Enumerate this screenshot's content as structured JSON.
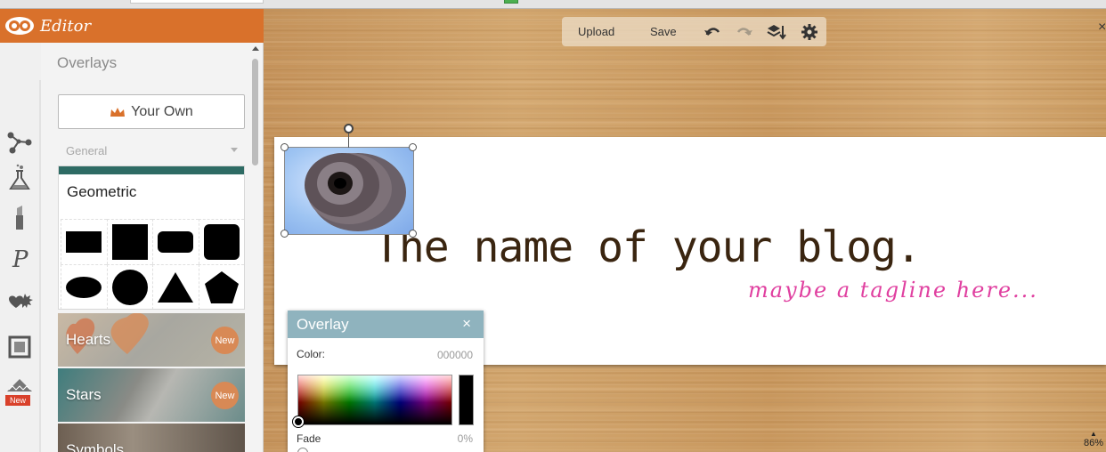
{
  "app": {
    "title": "Editor"
  },
  "toolbar": {
    "upload": "Upload",
    "save": "Save"
  },
  "sidebar": {
    "panel_title": "Overlays",
    "your_own_label": "Your Own",
    "category_select": "General",
    "geometric_title": "Geometric",
    "categories": [
      {
        "label": "Hearts",
        "badge": "New"
      },
      {
        "label": "Stars",
        "badge": "New"
      },
      {
        "label": "Symbols",
        "badge": ""
      }
    ],
    "new_badge_icon_label": "New"
  },
  "canvas": {
    "blog_name": "The name of your blog.",
    "tagline": "maybe a tagline here..."
  },
  "overlay_panel": {
    "title": "Overlay",
    "close": "×",
    "color_label": "Color:",
    "color_value": "000000",
    "fade_label": "Fade",
    "fade_value": "0%",
    "color_hex": "#000000"
  },
  "zoom": {
    "up": "▲",
    "value": "86%"
  },
  "window": {
    "close": "×"
  },
  "colors": {
    "brand": "#d9712b",
    "overlay_head": "#8fb3be",
    "tagline": "#e040a0",
    "blog_name": "#3a2510"
  },
  "icons": [
    "logo-icon",
    "connections-icon",
    "flask-icon",
    "lipstick-icon",
    "text-p-icon",
    "overlays-icon",
    "frames-icon",
    "textures-icon",
    "crown-icon",
    "undo-icon",
    "redo-icon",
    "layers-icon",
    "gear-icon"
  ]
}
